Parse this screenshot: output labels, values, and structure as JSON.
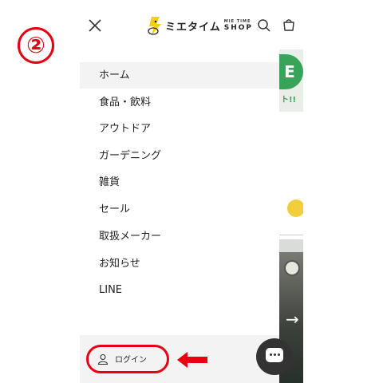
{
  "step_marker": "②",
  "header": {
    "logo_main": "ミエタイム",
    "logo_sub_top": "MIE TIME",
    "logo_sub_bottom": "SHOP"
  },
  "menu": {
    "items": [
      {
        "label": "ホーム",
        "active": true
      },
      {
        "label": "食品・飲料"
      },
      {
        "label": "アウトドア"
      },
      {
        "label": "ガーデニング"
      },
      {
        "label": "雑貨"
      },
      {
        "label": "セール"
      },
      {
        "label": "取扱メーカー"
      },
      {
        "label": "お知らせ"
      },
      {
        "label": "LINE"
      }
    ]
  },
  "footer": {
    "login_label": "ログイン"
  },
  "background": {
    "banner_letter": "E",
    "banner_text": "ト!!"
  },
  "colors": {
    "annotation_red": "#e60012",
    "active_row_bg": "#f3f3f3",
    "banner_green": "#3aa35a"
  },
  "icons": [
    "close-icon",
    "logo-icon",
    "search-icon",
    "cart-icon",
    "user-icon",
    "chat-icon",
    "arrow-left-icon"
  ]
}
